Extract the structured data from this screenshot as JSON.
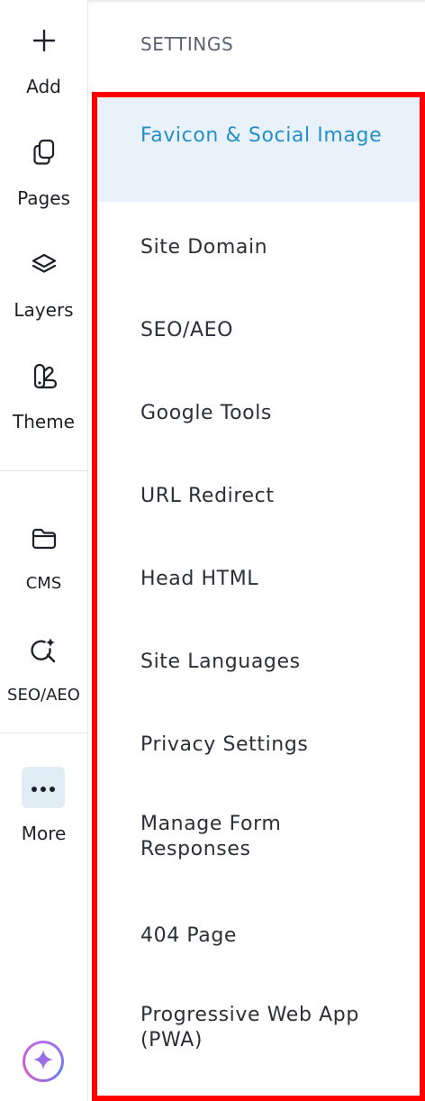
{
  "rail": {
    "items": [
      {
        "label": "Add",
        "icon": "plus-icon"
      },
      {
        "label": "Pages",
        "icon": "pages-icon"
      },
      {
        "label": "Layers",
        "icon": "layers-icon"
      },
      {
        "label": "Theme",
        "icon": "theme-icon"
      },
      {
        "label": "CMS",
        "icon": "folder-icon"
      },
      {
        "label": "SEO/AEO",
        "icon": "seo-search-icon"
      },
      {
        "label": "More",
        "icon": "more-dots-icon"
      }
    ],
    "ai_icon": "sparkle-icon"
  },
  "settings": {
    "title": "SETTINGS",
    "active_index": 0,
    "items": [
      {
        "label": "Favicon & Social Image"
      },
      {
        "label": "Site Domain"
      },
      {
        "label": "SEO/AEO"
      },
      {
        "label": "Google Tools"
      },
      {
        "label": "URL Redirect"
      },
      {
        "label": "Head HTML"
      },
      {
        "label": "Site Languages"
      },
      {
        "label": "Privacy Settings"
      },
      {
        "label": "Manage Form Responses"
      },
      {
        "label": "404 Page"
      },
      {
        "label": "Progressive Web App (PWA)"
      }
    ]
  },
  "colors": {
    "accent": "#2590c6",
    "active_bg": "#e9f1fb",
    "highlight_border": "#ff0000",
    "more_bg": "#e1edf5"
  }
}
